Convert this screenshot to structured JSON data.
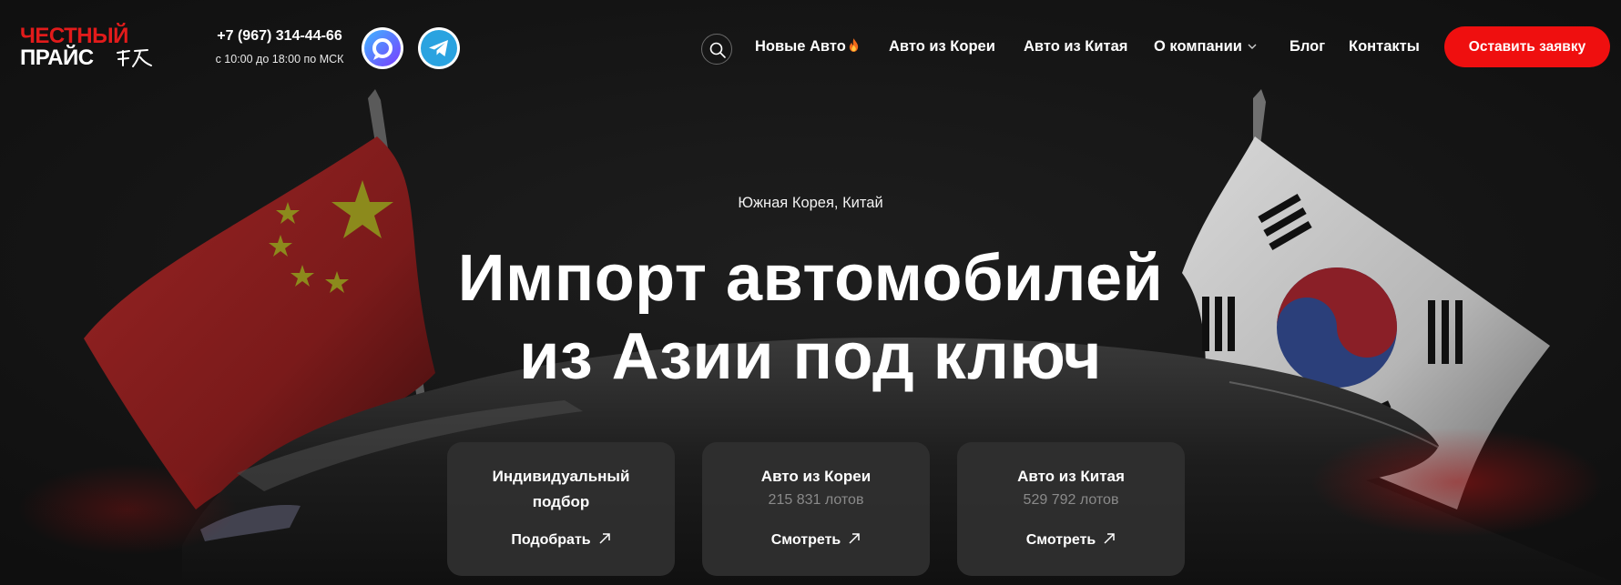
{
  "header": {
    "logo": {
      "line1": "ЧЕСТНЫЙ",
      "line2": "ПРАЙС",
      "glyph_icon": "hieroglyph-mark-icon"
    },
    "phone": "+7 (967) 314-44-66",
    "hours": "с 10:00 до 18:00 по МСК",
    "social": [
      {
        "icon": "max-messenger-icon"
      },
      {
        "icon": "telegram-icon"
      }
    ],
    "search_icon": "search-icon",
    "nav": {
      "new_cars": "Новые Авто",
      "korea": "Авто из Кореи",
      "china": "Авто из Китая",
      "about": "О компании",
      "blog": "Блог",
      "contacts": "Контакты"
    },
    "cta_label": "Оставить заявку"
  },
  "hero": {
    "eyebrow": "Южная Корея, Китай",
    "headline_line1": "Импорт автомобилей",
    "headline_line2": "из Азии под ключ"
  },
  "cards": [
    {
      "title_line1": "Индивидуальный",
      "title_line2": "подбор",
      "link": "Подобрать"
    },
    {
      "title": "Авто из Кореи",
      "count": "215 831 лотов",
      "link": "Смотреть"
    },
    {
      "title": "Авто из Китая",
      "count": "529 792 лотов",
      "link": "Смотреть"
    }
  ],
  "colors": {
    "accent": "#ef0f0f",
    "background": "#141414",
    "card": "#303030",
    "muted_text": "#8a8a8a"
  }
}
